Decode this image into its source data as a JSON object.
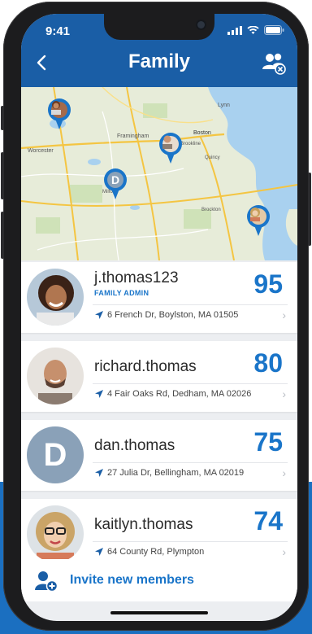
{
  "status": {
    "time": "9:41"
  },
  "header": {
    "title": "Family",
    "back_icon": "chevron-left-icon",
    "family_icon": "family-settings-icon"
  },
  "colors": {
    "brand": "#1a5ea6",
    "accent": "#1a75c9",
    "background_band": "#1b6fc0"
  },
  "members": [
    {
      "name": "j.thomas123",
      "role": "FAMILY ADMIN",
      "score": "95",
      "address": "6 French Dr, Boylston, MA 01505",
      "avatar": "photo"
    },
    {
      "name": "richard.thomas",
      "role": "",
      "score": "80",
      "address": "4 Fair Oaks Rd, Dedham, MA 02026",
      "avatar": "photo"
    },
    {
      "name": "dan.thomas",
      "role": "",
      "score": "75",
      "address": "27 Julia Dr, Bellingham, MA 02019",
      "avatar": "D"
    },
    {
      "name": "kaitlyn.thomas",
      "role": "",
      "score": "74",
      "address": "64 County Rd, Plympton",
      "avatar": "photo"
    }
  ],
  "map": {
    "labels": [
      "Lynn",
      "Boston",
      "Brookline",
      "Quincy",
      "Framingham",
      "Worcester",
      "Milford",
      "Brockton"
    ],
    "pin_initial": "D"
  },
  "invite": {
    "label": "Invite new members"
  }
}
